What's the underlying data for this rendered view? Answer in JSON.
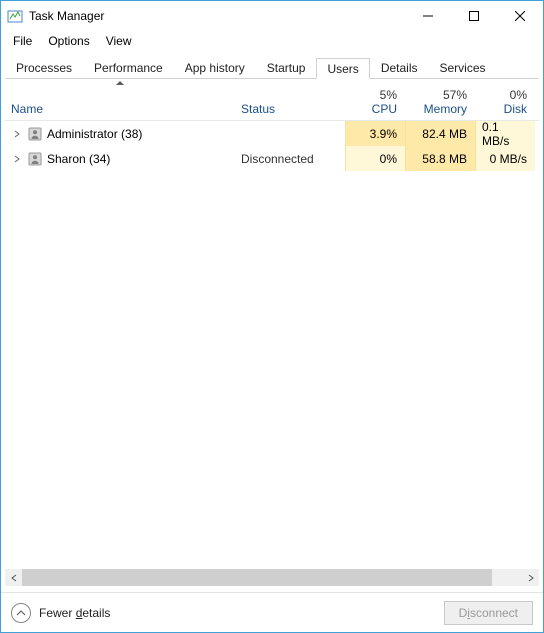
{
  "window": {
    "title": "Task Manager"
  },
  "menu": {
    "file": "File",
    "options": "Options",
    "view": "View"
  },
  "tabs": {
    "processes": "Processes",
    "performance": "Performance",
    "app_history": "App history",
    "startup": "Startup",
    "users": "Users",
    "details": "Details",
    "services": "Services",
    "active": "users"
  },
  "columns": {
    "name": "Name",
    "status": "Status",
    "cpu_pct": "5%",
    "cpu_label": "CPU",
    "mem_pct": "57%",
    "mem_label": "Memory",
    "disk_pct": "0%",
    "disk_label": "Disk",
    "sorted_by": "name",
    "sort_dir": "asc"
  },
  "rows": [
    {
      "name": "Administrator (38)",
      "status": "",
      "cpu": "3.9%",
      "memory": "82.4 MB",
      "disk": "0.1 MB/s",
      "cpu_heat": "med",
      "mem_heat": "med",
      "disk_heat": "light"
    },
    {
      "name": "Sharon (34)",
      "status": "Disconnected",
      "cpu": "0%",
      "memory": "58.8 MB",
      "disk": "0 MB/s",
      "cpu_heat": "light",
      "mem_heat": "med",
      "disk_heat": "light"
    }
  ],
  "footer": {
    "fewer_details": "Fewer details",
    "disconnect": "Disconnect",
    "disconnect_enabled": false
  }
}
